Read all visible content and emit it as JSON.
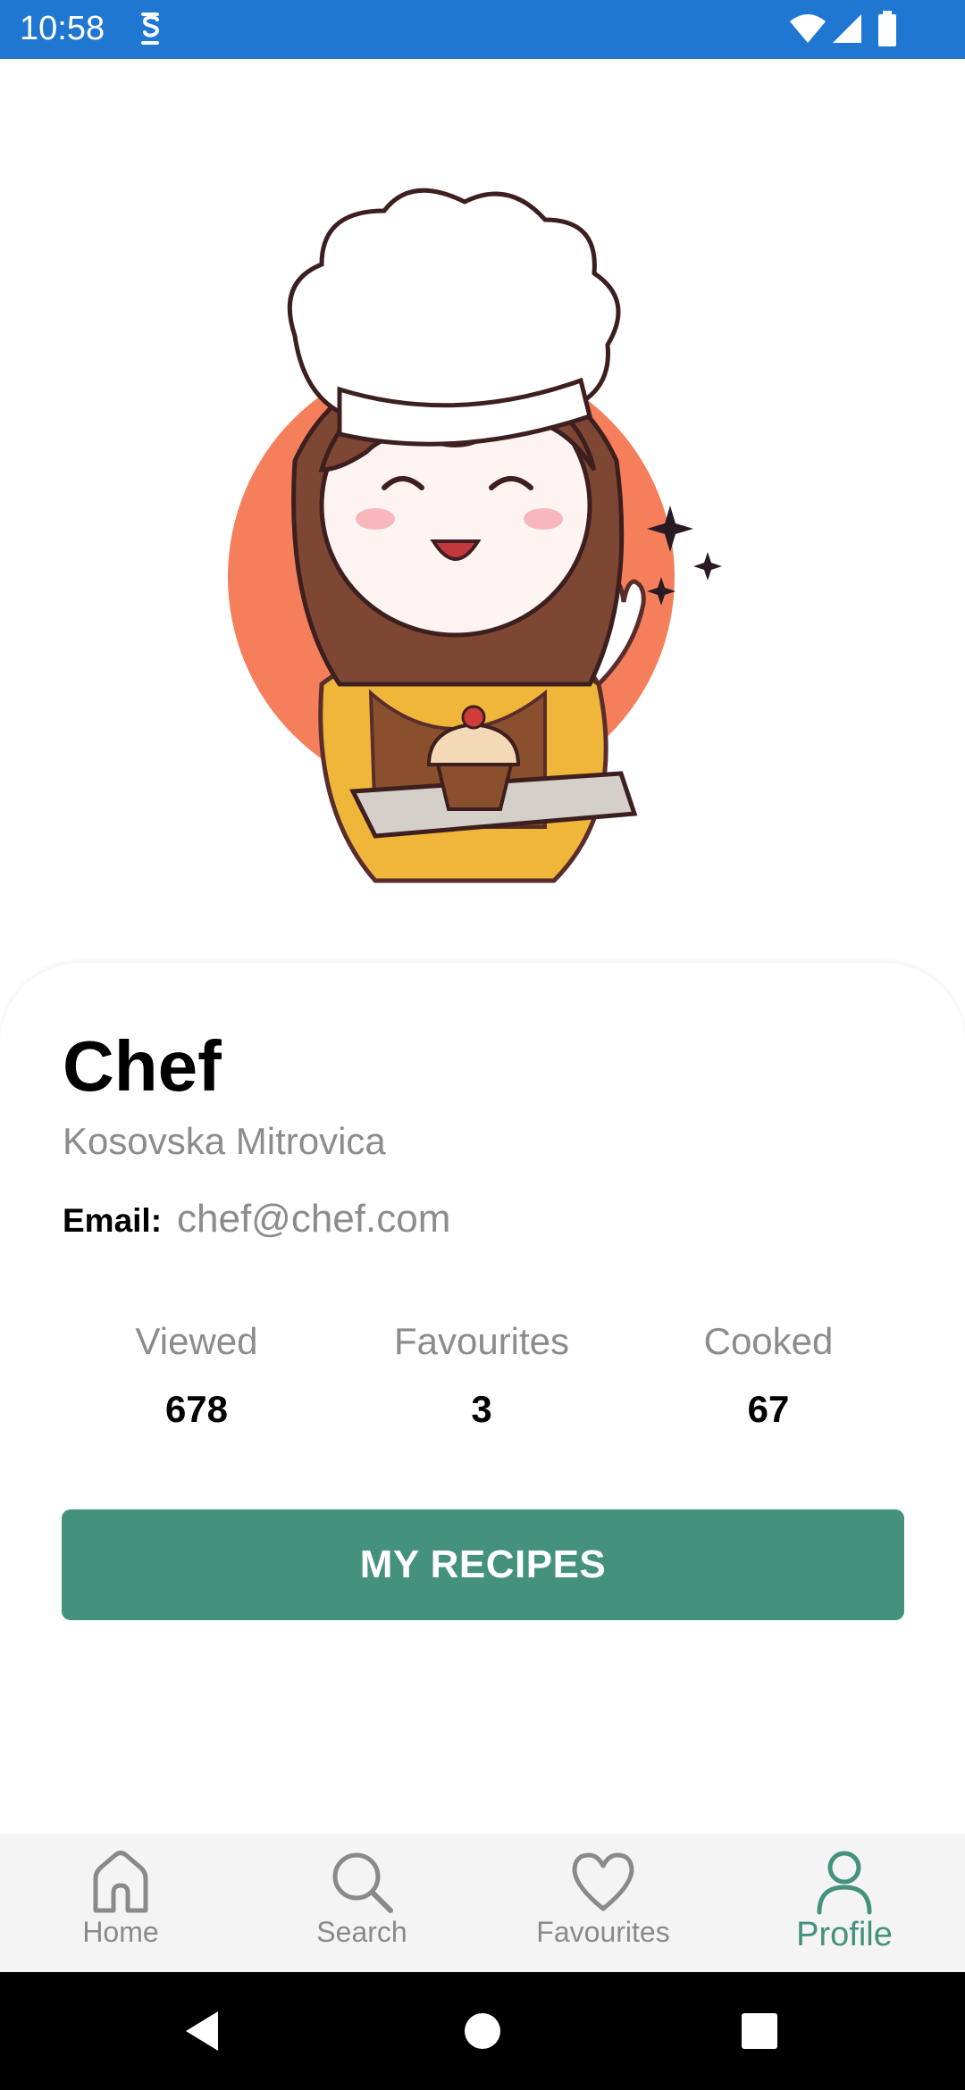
{
  "status_bar": {
    "time": "10:58",
    "color": "#1f77d2"
  },
  "profile": {
    "name": "Chef",
    "location": "Kosovska Mitrovica",
    "email_label": "Email:",
    "email": "chef@chef.com"
  },
  "stats": [
    {
      "label": "Viewed",
      "value": "678"
    },
    {
      "label": "Favourites",
      "value": "3"
    },
    {
      "label": "Cooked",
      "value": "67"
    }
  ],
  "button": {
    "label": "MY RECIPES",
    "color": "#44917c"
  },
  "nav": {
    "items": [
      {
        "label": "Home",
        "icon": "home-icon"
      },
      {
        "label": "Search",
        "icon": "search-icon"
      },
      {
        "label": "Favourites",
        "icon": "heart-icon"
      },
      {
        "label": "Profile",
        "icon": "person-icon",
        "active": true
      }
    ],
    "active_color": "#44917c"
  }
}
